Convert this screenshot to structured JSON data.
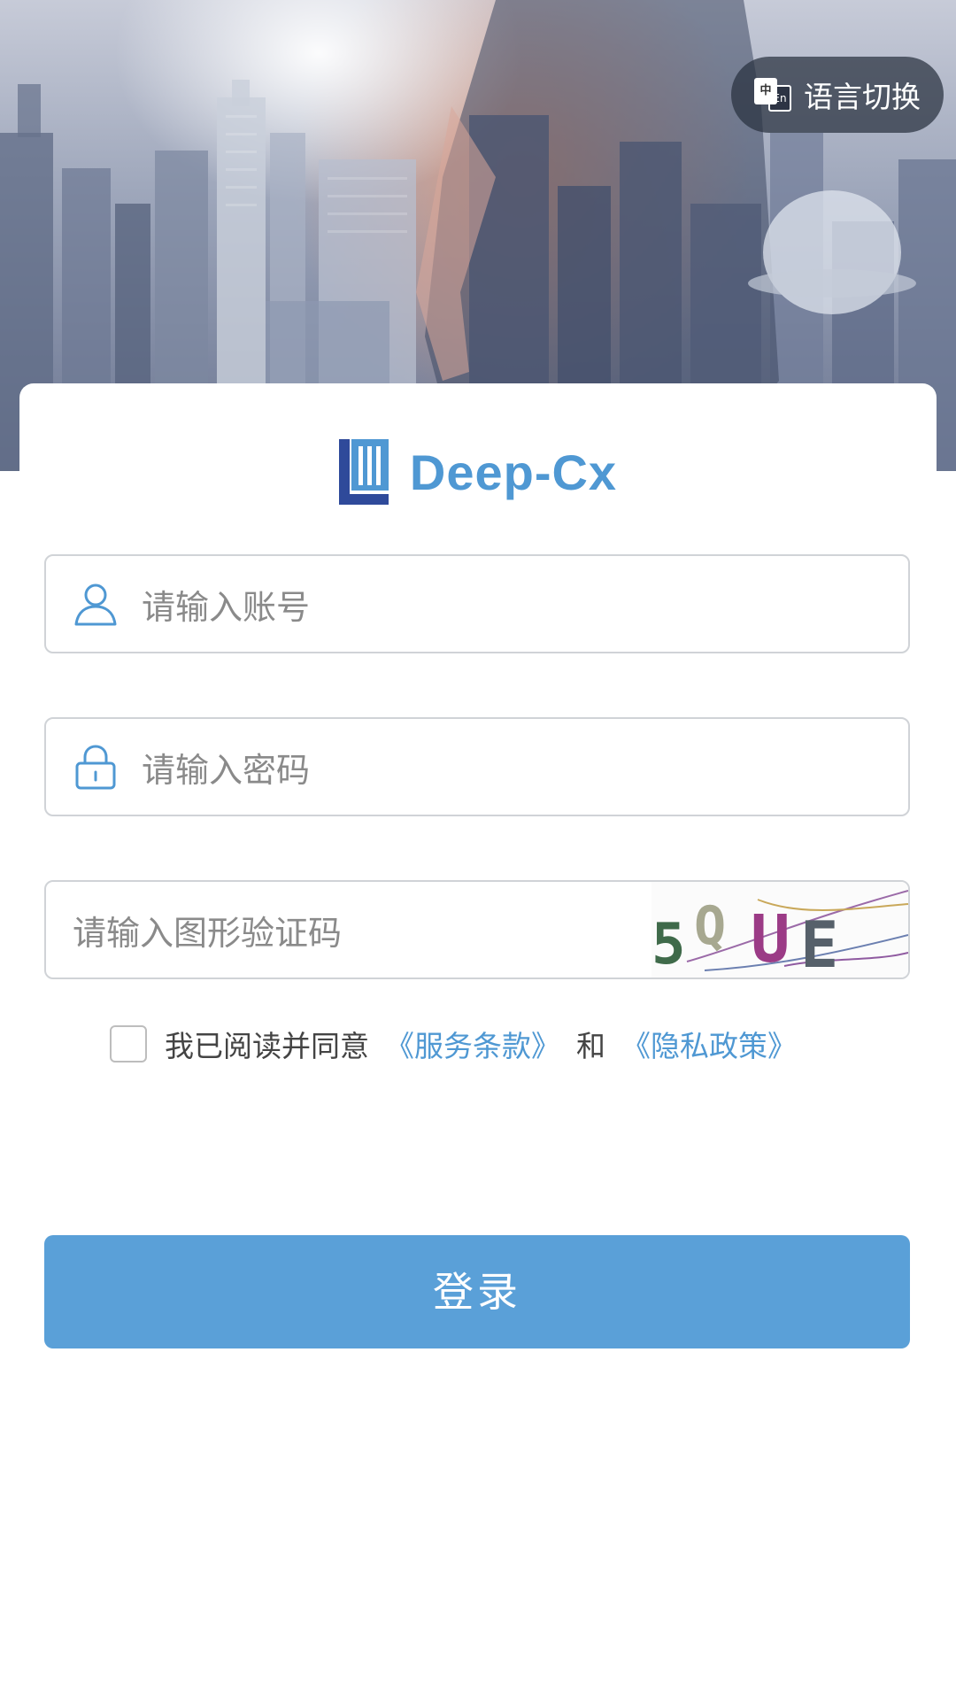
{
  "header": {
    "language_switch_label": "语言切换",
    "language_icon": {
      "front_glyph": "中",
      "back_glyph": "En"
    }
  },
  "brand": {
    "name": "Deep-Cx",
    "logo_colors": {
      "mark_dark": "#2f4a9a",
      "text": "#4f98d3"
    }
  },
  "form": {
    "account": {
      "placeholder": "请输入账号",
      "icon": "user-icon"
    },
    "password": {
      "placeholder": "请输入密码",
      "icon": "lock-icon"
    },
    "captcha": {
      "placeholder": "请输入图形验证码",
      "image_text": "5QUE"
    }
  },
  "agreement": {
    "checked": false,
    "prefix": "我已阅读并同意",
    "terms_link": "《服务条款》",
    "conjunction": "和",
    "privacy_link": "《隐私政策》"
  },
  "actions": {
    "login_label": "登录"
  },
  "colors": {
    "accent": "#5aa0d8",
    "link": "#4f98d3",
    "placeholder": "#8a8a8a",
    "border": "#d0d3d7"
  }
}
